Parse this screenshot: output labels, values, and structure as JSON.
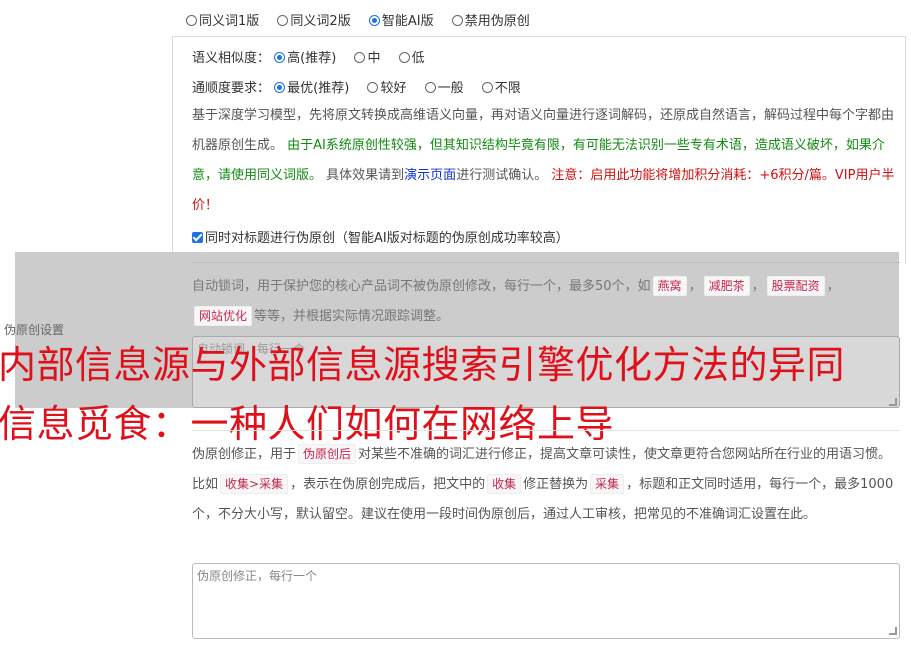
{
  "mode_options": [
    {
      "label": "同义词1版",
      "selected": false
    },
    {
      "label": "同义词2版",
      "selected": false
    },
    {
      "label": "智能AI版",
      "selected": true
    },
    {
      "label": "禁用伪原创",
      "selected": false
    }
  ],
  "similarity": {
    "label": "语义相似度：",
    "options": [
      {
        "label": "高(推荐)",
        "selected": true
      },
      {
        "label": "中",
        "selected": false
      },
      {
        "label": "低",
        "selected": false
      }
    ]
  },
  "fluency": {
    "label": "通顺度要求：",
    "options": [
      {
        "label": "最优(推荐)",
        "selected": true
      },
      {
        "label": "较好",
        "selected": false
      },
      {
        "label": "一般",
        "selected": false
      },
      {
        "label": "不限",
        "selected": false
      }
    ]
  },
  "description": {
    "part1": "基于深度学习模型，先将原文转换成高维语义向量，再对语义向量进行逐词解码，还原成自然语言，解码过程中每个字都由机器原创生成。",
    "part2": "由于AI系统原创性较强，但其知识结构毕竟有限，有可能无法识别一些专有术语，造成语义破坏，如果介意，请使用同义词版。",
    "part3": "具体效果请到",
    "link": "演示页面",
    "part4": "进行测试确认。",
    "warning": "注意：启用此功能将增加积分消耗：+6积分/篇。VIP用户半价！"
  },
  "title_checkbox": {
    "label": "同时对标题进行伪原创（智能AI版对标题的伪原创成功率较高）",
    "checked": true
  },
  "section_label": "伪原创设置",
  "lock_words": {
    "text1": "自动锁词，用于保护您的核心产品词不被伪原创修改，每行一个，最多50个，如",
    "examples": [
      "燕窝",
      "减肥茶",
      "股票配资",
      "网站优化"
    ],
    "text2": "等等，并根据实际情况跟踪调整。",
    "placeholder": "自动锁词，每行一个"
  },
  "overlay_title": {
    "line1": "内部信息源与外部信息源搜索引擎优化方法的异同",
    "line2": "信息觅食：一种人们如何在网络上导"
  },
  "correction": {
    "text1": "伪原创修正，用于",
    "tag1": "伪原创后",
    "text2": "对某些不准确的词汇进行修正，提高文章可读性，使文章更符合您网站所在行业的用语习惯。比如",
    "tag2": "收集>采集",
    "text3": "，表示在伪原创完成后，把文中的",
    "tag3": "收集",
    "text4": "修正替换为",
    "tag4": "采集",
    "text5": "，标题和正文同时适用，每行一个，最多1000个，不分大小写，默认留空。建议在使用一段时间伪原创后，通过人工审核，把常见的不准确词汇设置在此。",
    "placeholder": "伪原创修正，每行一个"
  },
  "colors": {
    "accent": "#1a73e8",
    "green": "#128a12",
    "red": "#d01010",
    "overlay_title": "#e0101a"
  }
}
